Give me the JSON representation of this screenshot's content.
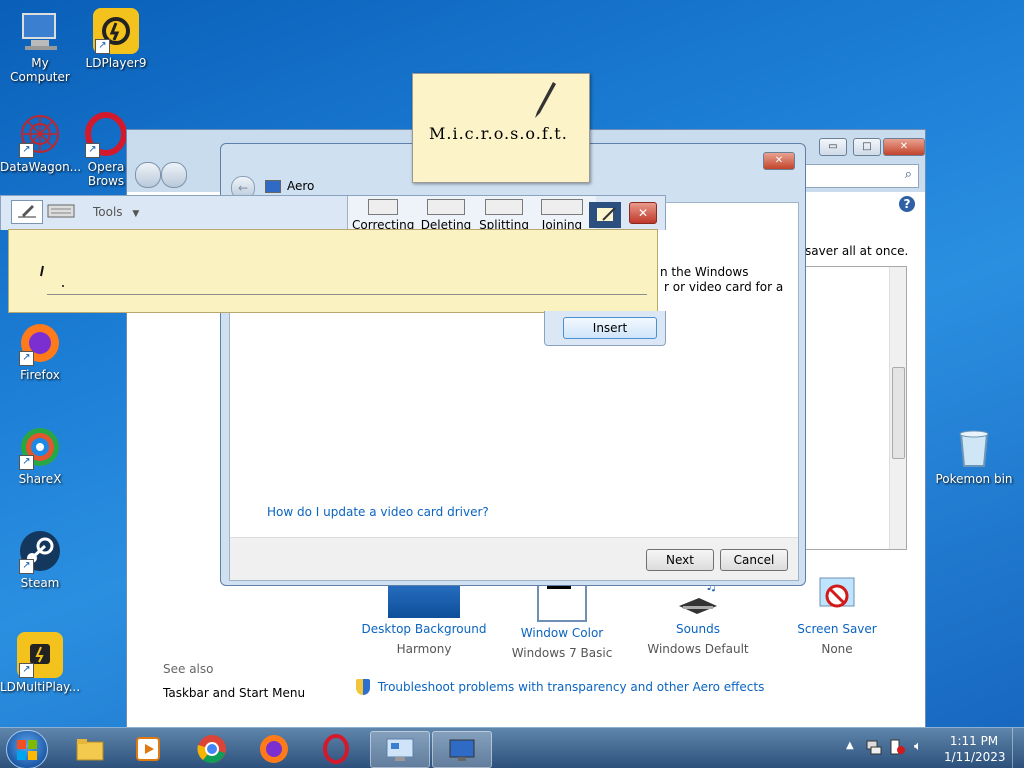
{
  "desktop": {
    "icons": [
      {
        "label": "My Computer",
        "icon": "computer-icon"
      },
      {
        "label": "LDPlayer9",
        "icon": "ldplayer-icon"
      },
      {
        "label": "DataWagon...",
        "icon": "datawagon-icon"
      },
      {
        "label": "Opera Brows",
        "icon": "opera-icon"
      },
      {
        "label": "Firefox",
        "icon": "firefox-icon"
      },
      {
        "label": "ShareX",
        "icon": "sharex-icon"
      },
      {
        "label": "Steam",
        "icon": "steam-icon"
      },
      {
        "label": "LDMultiPlay...",
        "icon": "ldmultiplayer-icon"
      },
      {
        "label": "Pokemon bin",
        "icon": "recycle-bin-icon"
      }
    ]
  },
  "back_window": {
    "partial_text": "saver all at once.",
    "features": [
      {
        "name": "Desktop Background",
        "value": "Harmony"
      },
      {
        "name": "Window Color",
        "value": "Windows 7 Basic"
      },
      {
        "name": "Sounds",
        "value": "Windows Default"
      },
      {
        "name": "Screen Saver",
        "value": "None"
      }
    ],
    "see_also_heading": "See also",
    "see_also_link": "Taskbar and Start Menu",
    "troubleshoot_link": "Troubleshoot problems with transparency and other Aero effects"
  },
  "dialog": {
    "title": "Aero",
    "text_line1": "n the Windows",
    "text_line2": "r or video card for a",
    "driver_link": "How do I update a video card driver?",
    "next_label": "Next",
    "cancel_label": "Cancel"
  },
  "input_panel": {
    "tools_label": "Tools",
    "tabs": [
      "Correcting",
      "Deleting",
      "Splitting",
      "Joining"
    ],
    "insert_label": "Insert"
  },
  "tooltip_logo_text": "M.i.c.r.o.s.o.f.t.",
  "taskbar": {
    "time": "1:11 PM",
    "date": "1/11/2023"
  },
  "colors": {
    "accent_link": "#0b64c0",
    "writing_pad": "#fbf2c2",
    "desktop_blue": "#1d7fd6"
  }
}
